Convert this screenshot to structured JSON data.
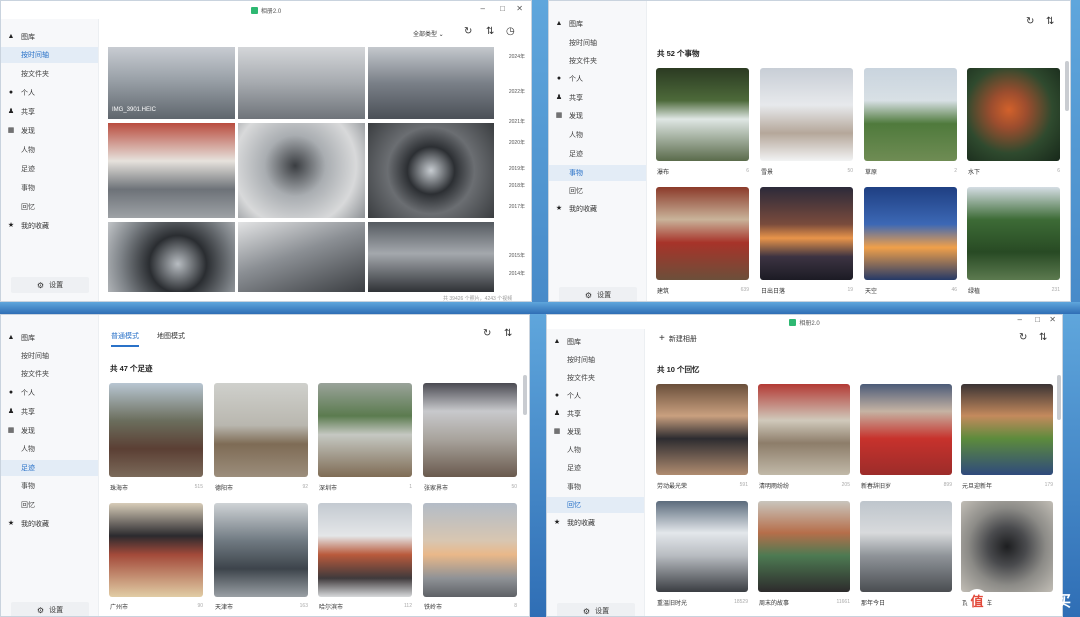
{
  "app": {
    "title": "相册2.0"
  },
  "sidebar": {
    "library": "图库",
    "timeline": "按时间轴",
    "folders": "按文件夹",
    "personal": "个人",
    "shared": "共享",
    "discover": "发现",
    "people": "人物",
    "footprints": "足迹",
    "things": "事物",
    "memories": "回忆",
    "favorites": "我的收藏",
    "settings": "设置"
  },
  "win_timeline": {
    "filter": "全部类型",
    "file_label": "IMG_3901.HEIC",
    "years": [
      "2024年",
      "2022年",
      "2021年",
      "2020年",
      "2019年",
      "2018年",
      "2017年",
      "2015年",
      "2014年"
    ],
    "footer": "共 39426 个照片，4243 个视频"
  },
  "win_things": {
    "heading": "共 52 个事物",
    "items": [
      {
        "name": "瀑布",
        "count": "6"
      },
      {
        "name": "雪景",
        "count": "50"
      },
      {
        "name": "草原",
        "count": "2"
      },
      {
        "name": "水下",
        "count": "6"
      },
      {
        "name": "建筑",
        "count": "639"
      },
      {
        "name": "日出日落",
        "count": "19"
      },
      {
        "name": "天空",
        "count": "46"
      },
      {
        "name": "绿植",
        "count": "231"
      }
    ]
  },
  "win_footprints": {
    "tab_normal": "普通模式",
    "tab_map": "地图模式",
    "heading": "共 47 个足迹",
    "items": [
      {
        "name": "珠海市",
        "count": "515"
      },
      {
        "name": "德阳市",
        "count": "92"
      },
      {
        "name": "深圳市",
        "count": "1"
      },
      {
        "name": "张家界市",
        "count": "50"
      },
      {
        "name": "广州市",
        "count": "90"
      },
      {
        "name": "天津市",
        "count": "163"
      },
      {
        "name": "哈尔滨市",
        "count": "112"
      },
      {
        "name": "铁岭市",
        "count": "8"
      }
    ]
  },
  "win_memories": {
    "new_album": "新建相册",
    "heading": "共 10 个回忆",
    "items": [
      {
        "name": "劳动最光荣",
        "count": "591"
      },
      {
        "name": "清明雨纷纷",
        "count": "205"
      },
      {
        "name": "新春辞旧岁",
        "count": "899"
      },
      {
        "name": "元旦迎新年",
        "count": "179"
      },
      {
        "name": "重温旧时光",
        "count": "18529"
      },
      {
        "name": "周末的故事",
        "count": "11661"
      },
      {
        "name": "那年今日",
        "count": ""
      },
      {
        "name": "瓦盖翻新车",
        "count": ""
      }
    ]
  },
  "watermark": {
    "text": "什么值得买",
    "glyph": "值"
  }
}
